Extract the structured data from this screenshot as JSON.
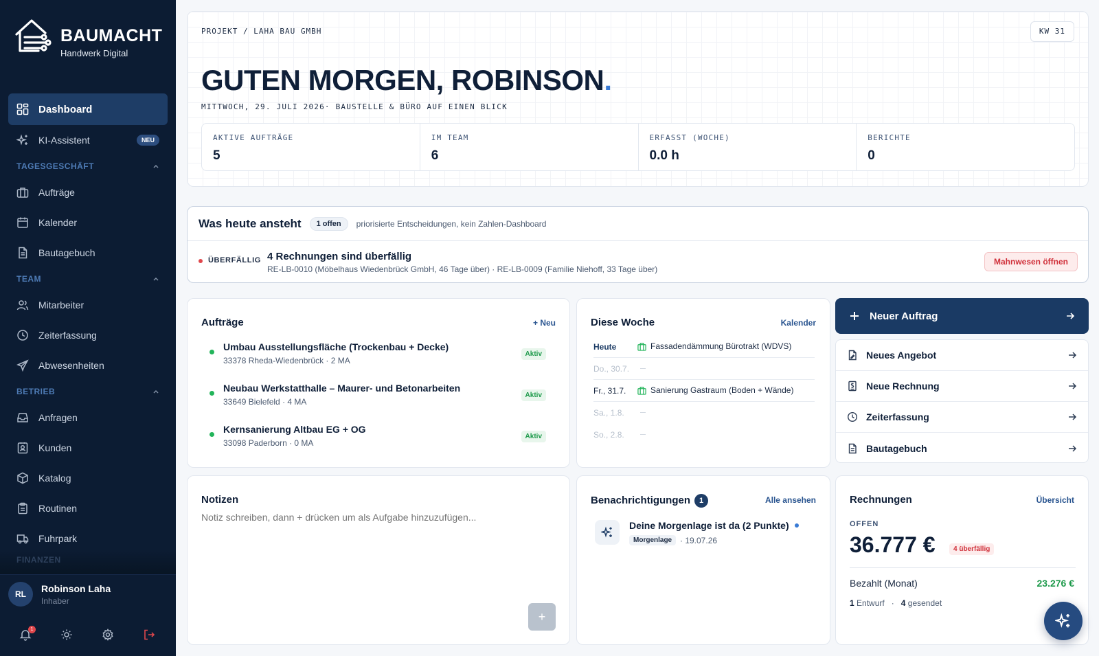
{
  "brand": {
    "name": "BAUMACHT",
    "tagline": "Handwerk Digital"
  },
  "sidebar": {
    "dashboard": "Dashboard",
    "ki": {
      "label": "KI-Assistent",
      "badge": "NEU"
    },
    "sec_tages": "TAGESGESCHÄFT",
    "auftraege": "Aufträge",
    "kalender": "Kalender",
    "bautagebuch": "Bautagebuch",
    "sec_team": "TEAM",
    "mitarbeiter": "Mitarbeiter",
    "zeiterfassung": "Zeiterfassung",
    "abwesenheiten": "Abwesenheiten",
    "sec_betrieb": "BETRIEB",
    "anfragen": "Anfragen",
    "kunden": "Kunden",
    "katalog": "Katalog",
    "routinen": "Routinen",
    "fuhrpark": "Fuhrpark",
    "sec_finanzen": "FINANZEN"
  },
  "user": {
    "initials": "RL",
    "name": "Robinson Laha",
    "role": "Inhaber",
    "notification_count": "1"
  },
  "hero": {
    "breadcrumb": "PROJEKT / LAHA BAU GMBH",
    "week": "KW 31",
    "greeting": "GUTEN MORGEN, ROBINSON",
    "greeting_dot": ".",
    "date_line": "MITTWOCH, 29. JULI 2026· BAUSTELLE & BÜRO AUF EINEN BLICK",
    "stats": [
      {
        "label": "AKTIVE AUFTRÄGE",
        "value": "5"
      },
      {
        "label": "IM TEAM",
        "value": "6"
      },
      {
        "label": "ERFASST (WOCHE)",
        "value": "0.0 h"
      },
      {
        "label": "BERICHTE",
        "value": "0"
      }
    ]
  },
  "today": {
    "title": "Was heute ansteht",
    "pill": "1 offen",
    "subtitle": "priorisierte Entscheidungen, kein Zahlen-Dashboard",
    "status": "ÜBERFÄLLIG",
    "main": "4 Rechnungen sind überfällig",
    "detail": "RE-LB-0010 (Möbelhaus Wiedenbrück GmbH, 46 Tage über) · RE-LB-0009 (Familie Niehoff, 33 Tage über)",
    "button": "Mahnwesen öffnen"
  },
  "orders": {
    "title": "Aufträge",
    "new_label": "+ Neu",
    "items": [
      {
        "title": "Umbau Ausstellungsfläche (Trockenbau + Decke)",
        "sub": "33378 Rheda-Wiedenbrück · 2 MA",
        "status": "Aktiv"
      },
      {
        "title": "Neubau Werkstatthalle – Maurer- und Betonarbeiten",
        "sub": "33649 Bielefeld · 4 MA",
        "status": "Aktiv"
      },
      {
        "title": "Kernsanierung Altbau EG + OG",
        "sub": "33098 Paderborn · 0 MA",
        "status": "Aktiv"
      }
    ]
  },
  "week": {
    "title": "Diese Woche",
    "link": "Kalender",
    "days": [
      {
        "label": "Heute",
        "event": "Fassadendämmung Bürotrakt (WDVS)"
      },
      {
        "label": "Do., 30.7.",
        "event": ""
      },
      {
        "label": "Fr., 31.7.",
        "event": "Sanierung Gastraum (Boden + Wände)"
      },
      {
        "label": "Sa., 1.8.",
        "event": ""
      },
      {
        "label": "So., 2.8.",
        "event": ""
      }
    ]
  },
  "quick": {
    "primary": "Neuer Auftrag",
    "items": [
      "Neues Angebot",
      "Neue Rechnung",
      "Zeiterfassung",
      "Bautagebuch"
    ]
  },
  "notes": {
    "title": "Notizen",
    "placeholder": "Notiz schreiben, dann + drücken um als Aufgabe hinzuzufügen...",
    "add_label": "+"
  },
  "notifications": {
    "title": "Benachrichtigungen",
    "count": "1",
    "link": "Alle ansehen",
    "item_title": "Deine Morgenlage ist da (2 Punkte)",
    "item_tag": "Morgenlage",
    "item_date": "· 19.07.26"
  },
  "invoices": {
    "title": "Rechnungen",
    "link": "Übersicht",
    "open_label": "OFFEN",
    "amount": "36.777 €",
    "overdue": "4 überfällig",
    "paid_label": "Bezahlt (Monat)",
    "paid_value": "23.276 €",
    "draft_count": "1",
    "draft_label": "Entwurf",
    "sep": "·",
    "sent_count": "4",
    "sent_label": "gesendet"
  },
  "colors": {
    "sidebar": "#0c1c33",
    "accent": "#1e3d66",
    "success": "#22b45a",
    "danger": "#e0474c"
  }
}
